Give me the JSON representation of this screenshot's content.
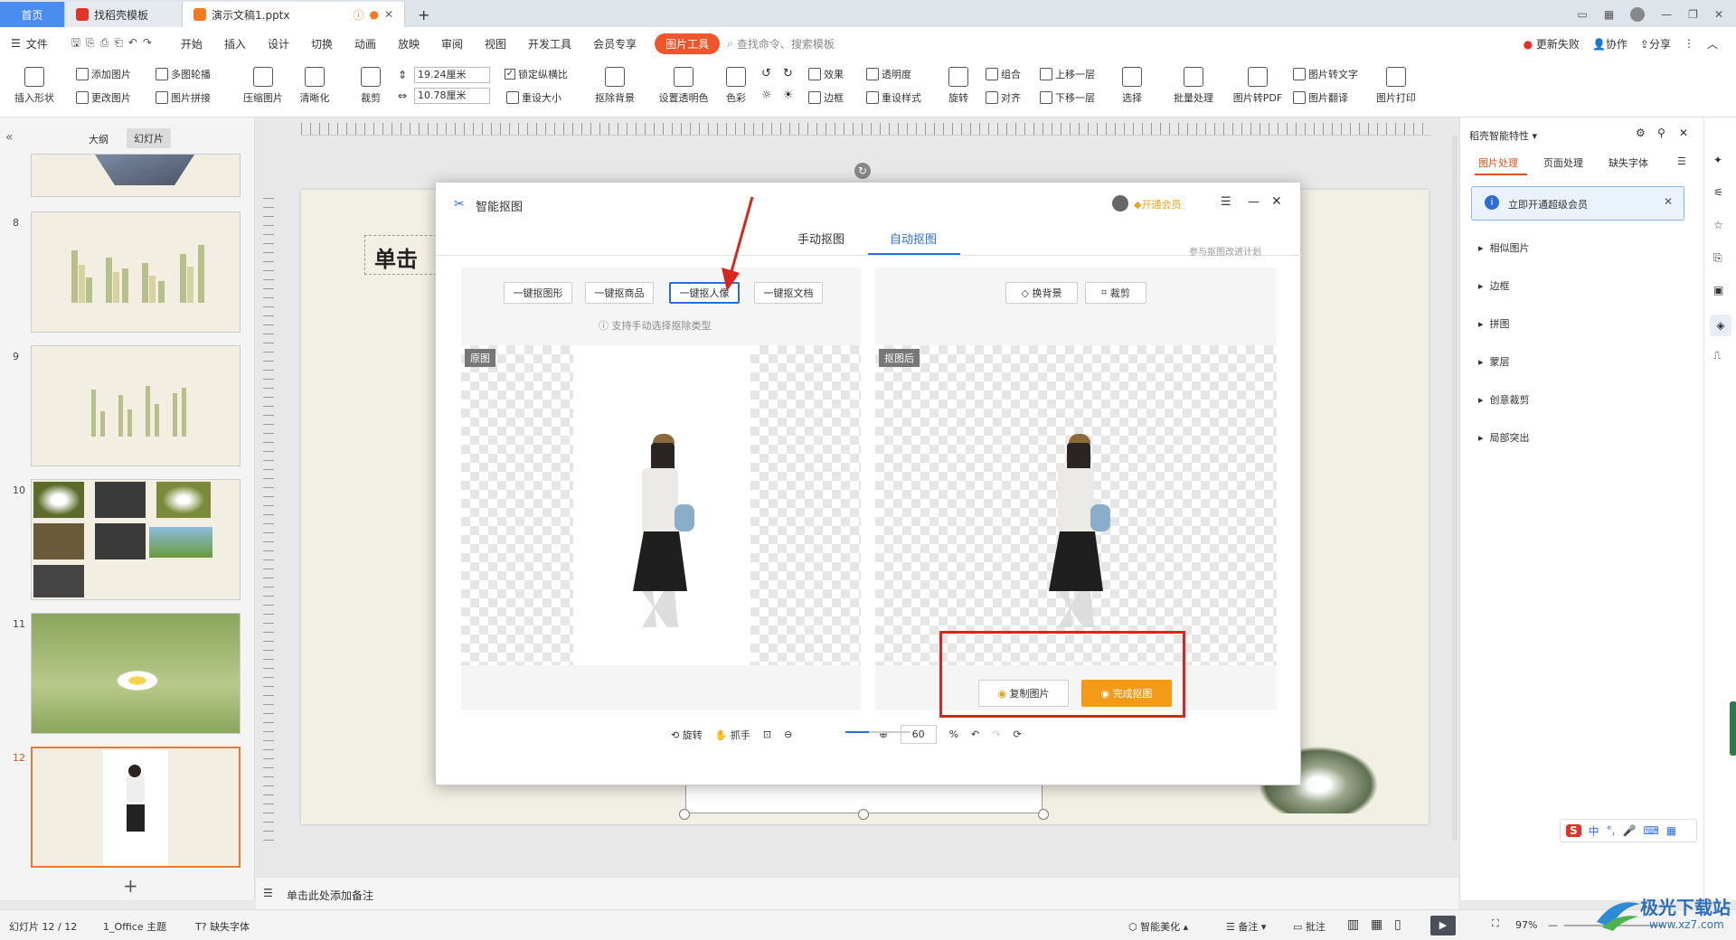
{
  "titlebar": {
    "home_tab": "首页",
    "template_tab": "找稻壳模板",
    "doc_tab": "演示文稿1.pptx",
    "new_tab": "+"
  },
  "menubar": {
    "file": "文件",
    "items": [
      "开始",
      "插入",
      "设计",
      "切换",
      "动画",
      "放映",
      "审阅",
      "视图",
      "开发工具",
      "会员专享"
    ],
    "active": "图片工具",
    "search_placeholder": "查找命令、搜索模板",
    "update_failed": "更新失败",
    "collab": "协作",
    "share": "分享"
  },
  "ribbon": {
    "insert_shape": "插入形状",
    "add_image": "添加图片",
    "change_image": "更改图片",
    "multi_outline": "多图轮播",
    "image_stitch": "图片拼接",
    "compress": "压缩图片",
    "clarify": "清晰化",
    "crop": "裁剪",
    "width_value": "19.24厘米",
    "height_value": "10.78厘米",
    "lock_ratio": "锁定纵横比",
    "reset_size": "重设大小",
    "remove_bg": "抠除背景",
    "set_transparent": "设置透明色",
    "color": "色彩",
    "effect": "效果",
    "border": "边框",
    "transparency": "透明度",
    "reset_style": "重设样式",
    "rotate": "旋转",
    "group": "组合",
    "align": "对齐",
    "move_up": "上移一层",
    "move_down": "下移一层",
    "select": "选择",
    "batch": "批量处理",
    "to_pdf": "图片转PDF",
    "to_text": "图片转文字",
    "translate": "图片翻译",
    "print": "图片打印"
  },
  "leftpanel": {
    "tab_outline": "大纲",
    "tab_slides": "幻灯片",
    "slide_numbers": [
      "8",
      "9",
      "10",
      "11",
      "12"
    ],
    "add_slide": "+"
  },
  "slide": {
    "title_placeholder": "单击"
  },
  "dialog": {
    "title": "智能抠图",
    "vip": "开通会员",
    "tab_manual": "手动抠图",
    "tab_auto": "自动抠图",
    "join_plan": "参与抠图改进计划",
    "types": [
      "一键抠图形",
      "一键抠商品",
      "一键抠人像",
      "一键抠文档"
    ],
    "hint": "支持手动选择抠除类型",
    "replace_bg": "换背景",
    "crop": "裁剪",
    "label_original": "原图",
    "label_result": "抠图后",
    "copy_image": "复制图片",
    "finish": "完成抠图",
    "rotate": "旋转",
    "grab": "抓手",
    "zoom_value": "60",
    "zoom_unit": "%"
  },
  "rightpanel": {
    "title": "稻壳智能特性",
    "tabs": [
      "图片处理",
      "页面处理",
      "缺失字体"
    ],
    "banner": "立即开通超级会员",
    "items": [
      "相似图片",
      "边框",
      "拼图",
      "蒙层",
      "创意裁剪",
      "局部突出"
    ]
  },
  "notes": {
    "placeholder": "单击此处添加备注"
  },
  "status": {
    "slide_info": "幻灯片 12 / 12",
    "theme": "1_Office 主题",
    "missing_font": "缺失字体",
    "beautify": "智能美化",
    "notes": "备注",
    "comment": "批注",
    "zoom": "97%"
  },
  "watermark": {
    "site": "极光下载站",
    "url": "www.xz7.com"
  },
  "ime": {
    "lang": "中"
  },
  "colors": {
    "accent_orange": "#f0542b",
    "tab_blue": "#2b6fd6",
    "finish_orange": "#f59a16",
    "annotation_red": "#d9261c"
  }
}
